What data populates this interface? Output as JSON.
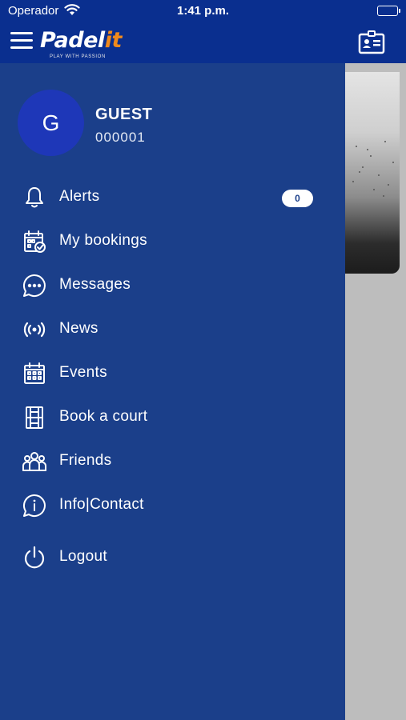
{
  "status_bar": {
    "carrier": "Operador",
    "time": "1:41 p.m."
  },
  "header": {
    "logo_main": "Padel",
    "logo_accent": "it",
    "logo_tagline": "PLAY WITH PASSION"
  },
  "user": {
    "initial": "G",
    "name": "GUEST",
    "id": "000001"
  },
  "menu": {
    "alerts": {
      "label": "Alerts",
      "badge": "0",
      "icon": "bell-icon"
    },
    "bookings": {
      "label": "My bookings",
      "icon": "calendar-check-icon"
    },
    "messages": {
      "label": "Messages",
      "icon": "chat-bubble-icon"
    },
    "news": {
      "label": "News",
      "icon": "broadcast-icon"
    },
    "events": {
      "label": "Events",
      "icon": "calendar-grid-icon"
    },
    "book_court": {
      "label": "Book a court",
      "icon": "court-icon"
    },
    "friends": {
      "label": "Friends",
      "icon": "group-icon"
    },
    "info": {
      "label": "Info|Contact",
      "icon": "info-bubble-icon"
    },
    "logout": {
      "label": "Logout",
      "icon": "power-icon"
    }
  },
  "colors": {
    "header": "#0a2f8f",
    "drawer": "#1b3f8a",
    "avatar": "#1e37b8",
    "logo_accent": "#f08a1c"
  }
}
